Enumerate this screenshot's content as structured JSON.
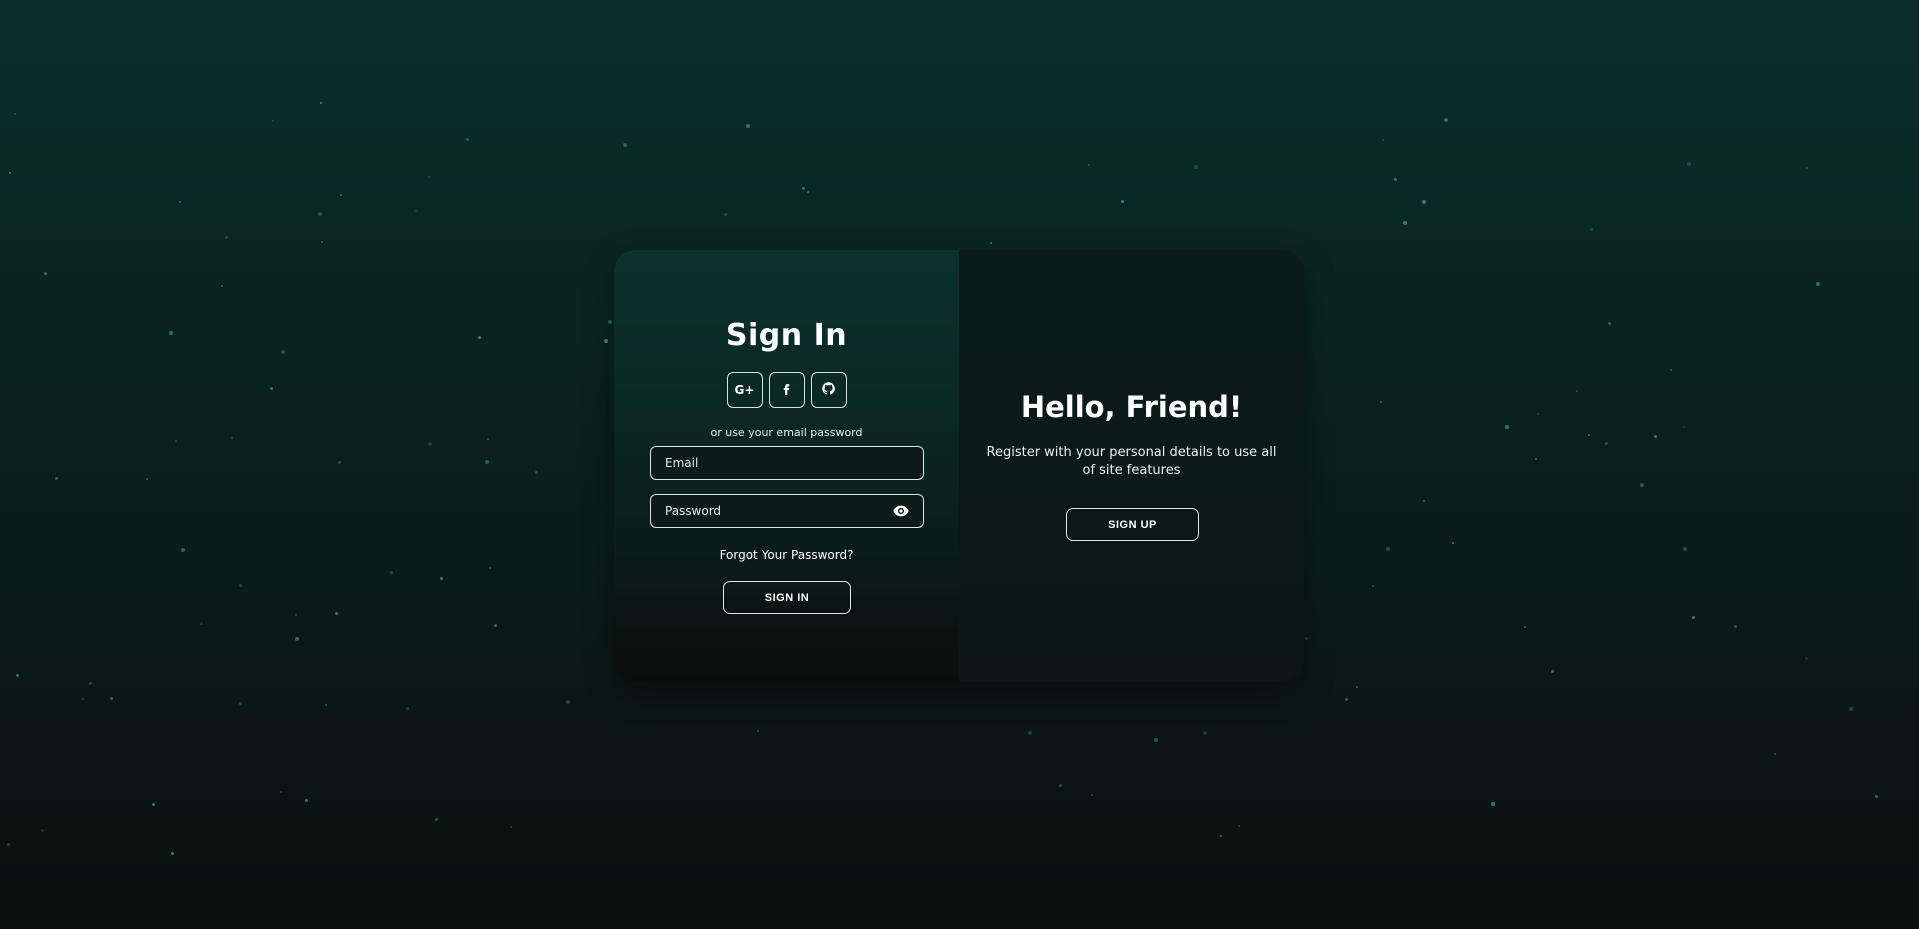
{
  "signin": {
    "title": "Sign In",
    "social": [
      {
        "label": "G+",
        "icon": "google-plus-icon"
      },
      {
        "label": "",
        "icon": "facebook-icon"
      },
      {
        "label": "",
        "icon": "github-icon"
      }
    ],
    "alt_text": "or use your email password",
    "email_placeholder": "Email",
    "password_placeholder": "Password",
    "forgot_label": "Forgot Your Password?",
    "button_label": "SIGN IN"
  },
  "signup_panel": {
    "title": "Hello, Friend!",
    "text": "Register with your personal details to use all of site features",
    "button_label": "SIGN UP"
  },
  "colors": {
    "accent_particle": "#2fa08a",
    "particle_blue": "#3a86b8",
    "border": "#dfe6e4"
  }
}
